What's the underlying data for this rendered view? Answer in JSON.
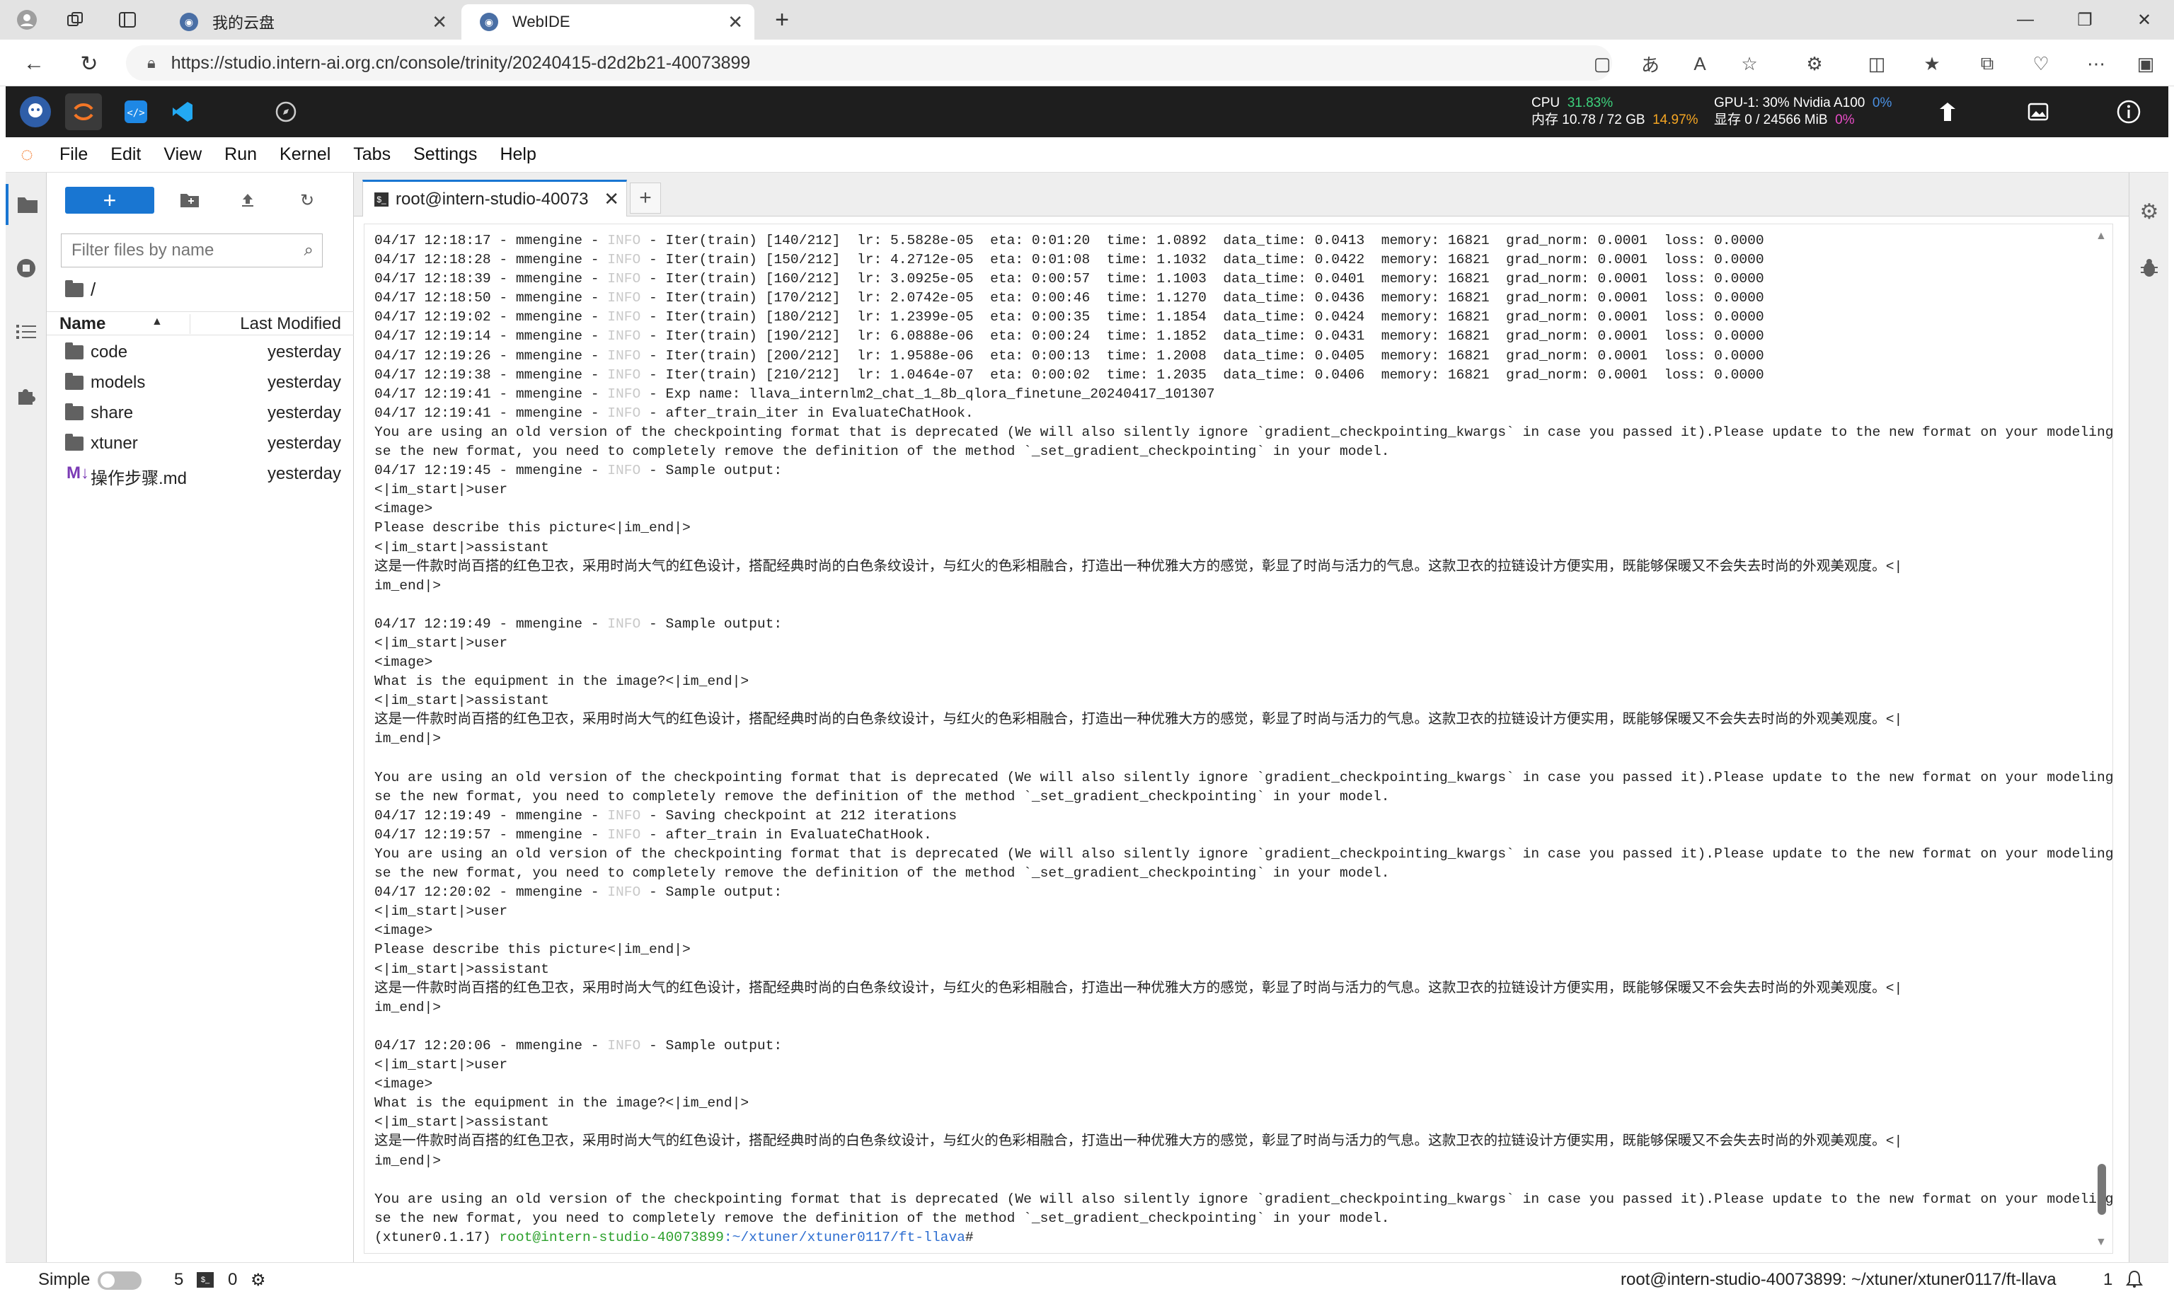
{
  "browser": {
    "tabs": [
      {
        "title": "我的云盘",
        "active": false
      },
      {
        "title": "WebIDE",
        "active": true
      }
    ],
    "url": "https://studio.intern-ai.org.cn/console/trinity/20240415-d2d2b21-40073899"
  },
  "ide": {
    "cpu_label": "CPU",
    "cpu_pct": "31.83%",
    "mem_label": "内存 10.78 / 72 GB",
    "mem_pct": "14.97%",
    "gpu_label": "GPU-1: 30% Nvidia A100",
    "gpu_pct": "0%",
    "vram_label": "显存 0 / 24566 MiB",
    "vram_pct": "0%"
  },
  "menu": [
    "File",
    "Edit",
    "View",
    "Run",
    "Kernel",
    "Tabs",
    "Settings",
    "Help"
  ],
  "filebrowser": {
    "filter_placeholder": "Filter files by name",
    "path": "/",
    "col_name": "Name",
    "col_modified": "Last Modified",
    "files": [
      {
        "name": "code",
        "type": "folder",
        "modified": "yesterday"
      },
      {
        "name": "models",
        "type": "folder",
        "modified": "yesterday"
      },
      {
        "name": "share",
        "type": "folder",
        "modified": "yesterday"
      },
      {
        "name": "xtuner",
        "type": "folder",
        "modified": "yesterday"
      },
      {
        "name": "操作步骤.md",
        "type": "markdown",
        "modified": "yesterday"
      }
    ]
  },
  "terminal": {
    "tab_title": "root@intern-studio-40073",
    "lines": [
      "04/17 12:18:17 - mmengine - INFO - Iter(train) [140/212]  lr: 5.5828e-05  eta: 0:01:20  time: 1.0892  data_time: 0.0413  memory: 16821  grad_norm: 0.0001  loss: 0.0000",
      "04/17 12:18:28 - mmengine - INFO - Iter(train) [150/212]  lr: 4.2712e-05  eta: 0:01:08  time: 1.1032  data_time: 0.0422  memory: 16821  grad_norm: 0.0001  loss: 0.0000",
      "04/17 12:18:39 - mmengine - INFO - Iter(train) [160/212]  lr: 3.0925e-05  eta: 0:00:57  time: 1.1003  data_time: 0.0401  memory: 16821  grad_norm: 0.0001  loss: 0.0000",
      "04/17 12:18:50 - mmengine - INFO - Iter(train) [170/212]  lr: 2.0742e-05  eta: 0:00:46  time: 1.1270  data_time: 0.0436  memory: 16821  grad_norm: 0.0001  loss: 0.0000",
      "04/17 12:19:02 - mmengine - INFO - Iter(train) [180/212]  lr: 1.2399e-05  eta: 0:00:35  time: 1.1854  data_time: 0.0424  memory: 16821  grad_norm: 0.0001  loss: 0.0000",
      "04/17 12:19:14 - mmengine - INFO - Iter(train) [190/212]  lr: 6.0888e-06  eta: 0:00:24  time: 1.1852  data_time: 0.0431  memory: 16821  grad_norm: 0.0001  loss: 0.0000",
      "04/17 12:19:26 - mmengine - INFO - Iter(train) [200/212]  lr: 1.9588e-06  eta: 0:00:13  time: 1.2008  data_time: 0.0405  memory: 16821  grad_norm: 0.0001  loss: 0.0000",
      "04/17 12:19:38 - mmengine - INFO - Iter(train) [210/212]  lr: 1.0464e-07  eta: 0:00:02  time: 1.2035  data_time: 0.0406  memory: 16821  grad_norm: 0.0001  loss: 0.0000",
      "04/17 12:19:41 - mmengine - INFO - Exp name: llava_internlm2_chat_1_8b_qlora_finetune_20240417_101307",
      "04/17 12:19:41 - mmengine - INFO - after_train_iter in EvaluateChatHook.",
      "You are using an old version of the checkpointing format that is deprecated (We will also silently ignore `gradient_checkpointing_kwargs` in case you passed it).Please update to the new format on your modeling file. To u",
      "se the new format, you need to completely remove the definition of the method `_set_gradient_checkpointing` in your model.",
      "04/17 12:19:45 - mmengine - INFO - Sample output:",
      "<|im_start|>user",
      "<image>",
      "Please describe this picture<|im_end|>",
      "<|im_start|>assistant",
      "这是一件款时尚百搭的红色卫衣，采用时尚大气的红色设计，搭配经典时尚的白色条纹设计，与红火的色彩相融合，打造出一种优雅大方的感觉，彰显了时尚与活力的气息。这款卫衣的拉链设计方便实用，既能够保暖又不会失去时尚的外观美观度。<|",
      "im_end|>",
      "",
      "04/17 12:19:49 - mmengine - INFO - Sample output:",
      "<|im_start|>user",
      "<image>",
      "What is the equipment in the image?<|im_end|>",
      "<|im_start|>assistant",
      "这是一件款时尚百搭的红色卫衣，采用时尚大气的红色设计，搭配经典时尚的白色条纹设计，与红火的色彩相融合，打造出一种优雅大方的感觉，彰显了时尚与活力的气息。这款卫衣的拉链设计方便实用，既能够保暖又不会失去时尚的外观美观度。<|",
      "im_end|>",
      "",
      "You are using an old version of the checkpointing format that is deprecated (We will also silently ignore `gradient_checkpointing_kwargs` in case you passed it).Please update to the new format on your modeling file. To u",
      "se the new format, you need to completely remove the definition of the method `_set_gradient_checkpointing` in your model.",
      "04/17 12:19:49 - mmengine - INFO - Saving checkpoint at 212 iterations",
      "04/17 12:19:57 - mmengine - INFO - after_train in EvaluateChatHook.",
      "You are using an old version of the checkpointing format that is deprecated (We will also silently ignore `gradient_checkpointing_kwargs` in case you passed it).Please update to the new format on your modeling file. To u",
      "se the new format, you need to completely remove the definition of the method `_set_gradient_checkpointing` in your model.",
      "04/17 12:20:02 - mmengine - INFO - Sample output:",
      "<|im_start|>user",
      "<image>",
      "Please describe this picture<|im_end|>",
      "<|im_start|>assistant",
      "这是一件款时尚百搭的红色卫衣，采用时尚大气的红色设计，搭配经典时尚的白色条纹设计，与红火的色彩相融合，打造出一种优雅大方的感觉，彰显了时尚与活力的气息。这款卫衣的拉链设计方便实用，既能够保暖又不会失去时尚的外观美观度。<|",
      "im_end|>",
      "",
      "04/17 12:20:06 - mmengine - INFO - Sample output:",
      "<|im_start|>user",
      "<image>",
      "What is the equipment in the image?<|im_end|>",
      "<|im_start|>assistant",
      "这是一件款时尚百搭的红色卫衣，采用时尚大气的红色设计，搭配经典时尚的白色条纹设计，与红火的色彩相融合，打造出一种优雅大方的感觉，彰显了时尚与活力的气息。这款卫衣的拉链设计方便实用，既能够保暖又不会失去时尚的外观美观度。<|",
      "im_end|>",
      "",
      "You are using an old version of the checkpointing format that is deprecated (We will also silently ignore `gradient_checkpointing_kwargs` in case you passed it).Please update to the new format on your modeling file. To u",
      "se the new format, you need to completely remove the definition of the method `_set_gradient_checkpointing` in your model."
    ],
    "prompt_env": "(xtuner0.1.17) ",
    "prompt_user": "root@intern-studio-40073899",
    "prompt_path": ":~/xtuner/xtuner0117/ft-llava",
    "prompt_end": "#"
  },
  "statusbar": {
    "mode_label": "Simple",
    "count1": "5",
    "count2": "0",
    "right_text": "root@intern-studio-40073899: ~/xtuner/xtuner0117/ft-llava",
    "right_count": "1"
  },
  "colors": {
    "accent": "#1976d2",
    "jupyter_orange": "#f37626",
    "ide_bar": "#1e1e1e",
    "resource_green": "#3dd17c"
  }
}
